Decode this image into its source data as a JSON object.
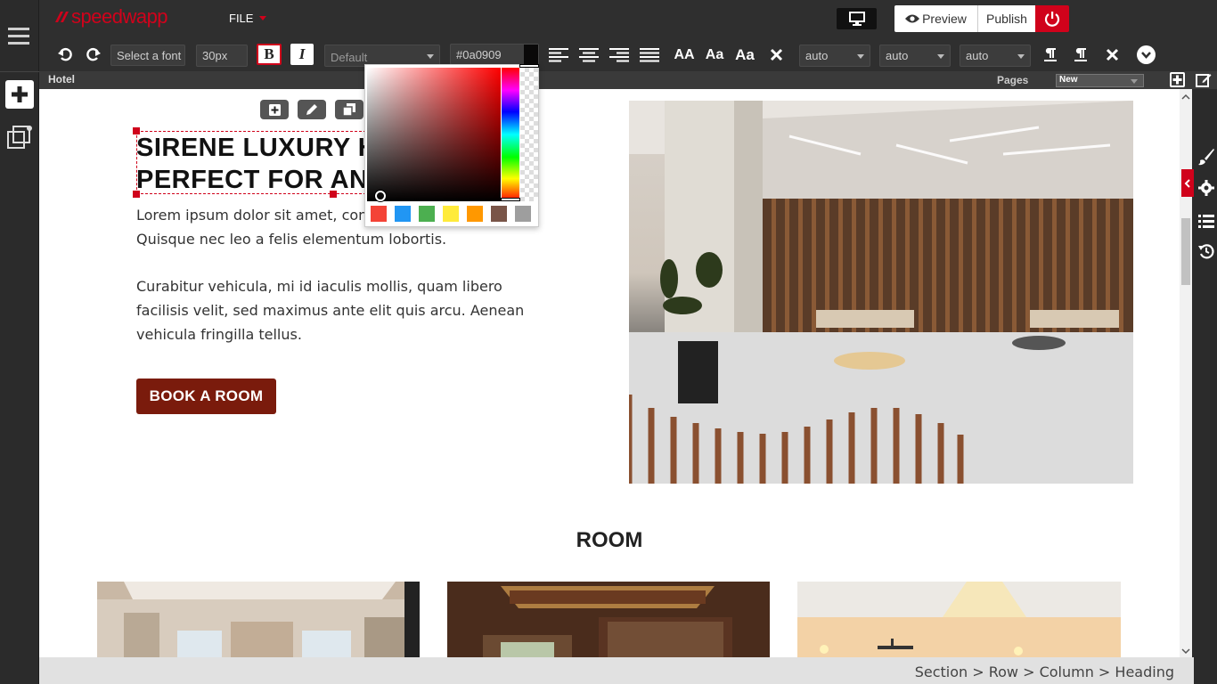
{
  "app": {
    "logo_text": "speedwapp",
    "file_menu": "FILE",
    "preview_label": "Preview",
    "publish_label": "Publish"
  },
  "toolbar": {
    "font_placeholder": "Select a font",
    "font_size": "30px",
    "bold_label": "B",
    "italic_label": "I",
    "style_select": "Default",
    "color_value": "#0a0909",
    "case_upper": "AA",
    "case_small": "Aa",
    "case_title": "Aa",
    "spacing_1": "auto",
    "spacing_2": "auto",
    "spacing_3": "auto"
  },
  "pagebar": {
    "page_name": "Hotel",
    "pages_label": "Pages",
    "pages_select": "New"
  },
  "color_picker": {
    "swatches": [
      "#f44336",
      "#2196f3",
      "#4caf50",
      "#ffeb3b",
      "#ff9800",
      "#795548",
      "#9e9e9e"
    ]
  },
  "hero": {
    "title_line1": "SIRENE LUXURY H",
    "title_line2": "PERFECT FOR ANY",
    "para1_line1": "Lorem ipsum dolor sit amet, con",
    "para1_line2": "Quisque nec leo a felis elementum lobortis.",
    "para2_line1": "Curabitur vehicula, mi id iaculis mollis, quam libero",
    "para2_line2": "facilisis velit, sed maximus ante elit quis arcu. Aenean",
    "para2_line3": "vehicula fringilla tellus.",
    "cta": "BOOK A ROOM",
    "cta_color": "#7a1b0c"
  },
  "rooms": {
    "heading": "ROOM"
  },
  "breadcrumb": {
    "text": "Section > Row > Column > Heading"
  },
  "colors": {
    "accent_red": "#d0021b",
    "toolbar_bg": "#2f2f2f"
  }
}
